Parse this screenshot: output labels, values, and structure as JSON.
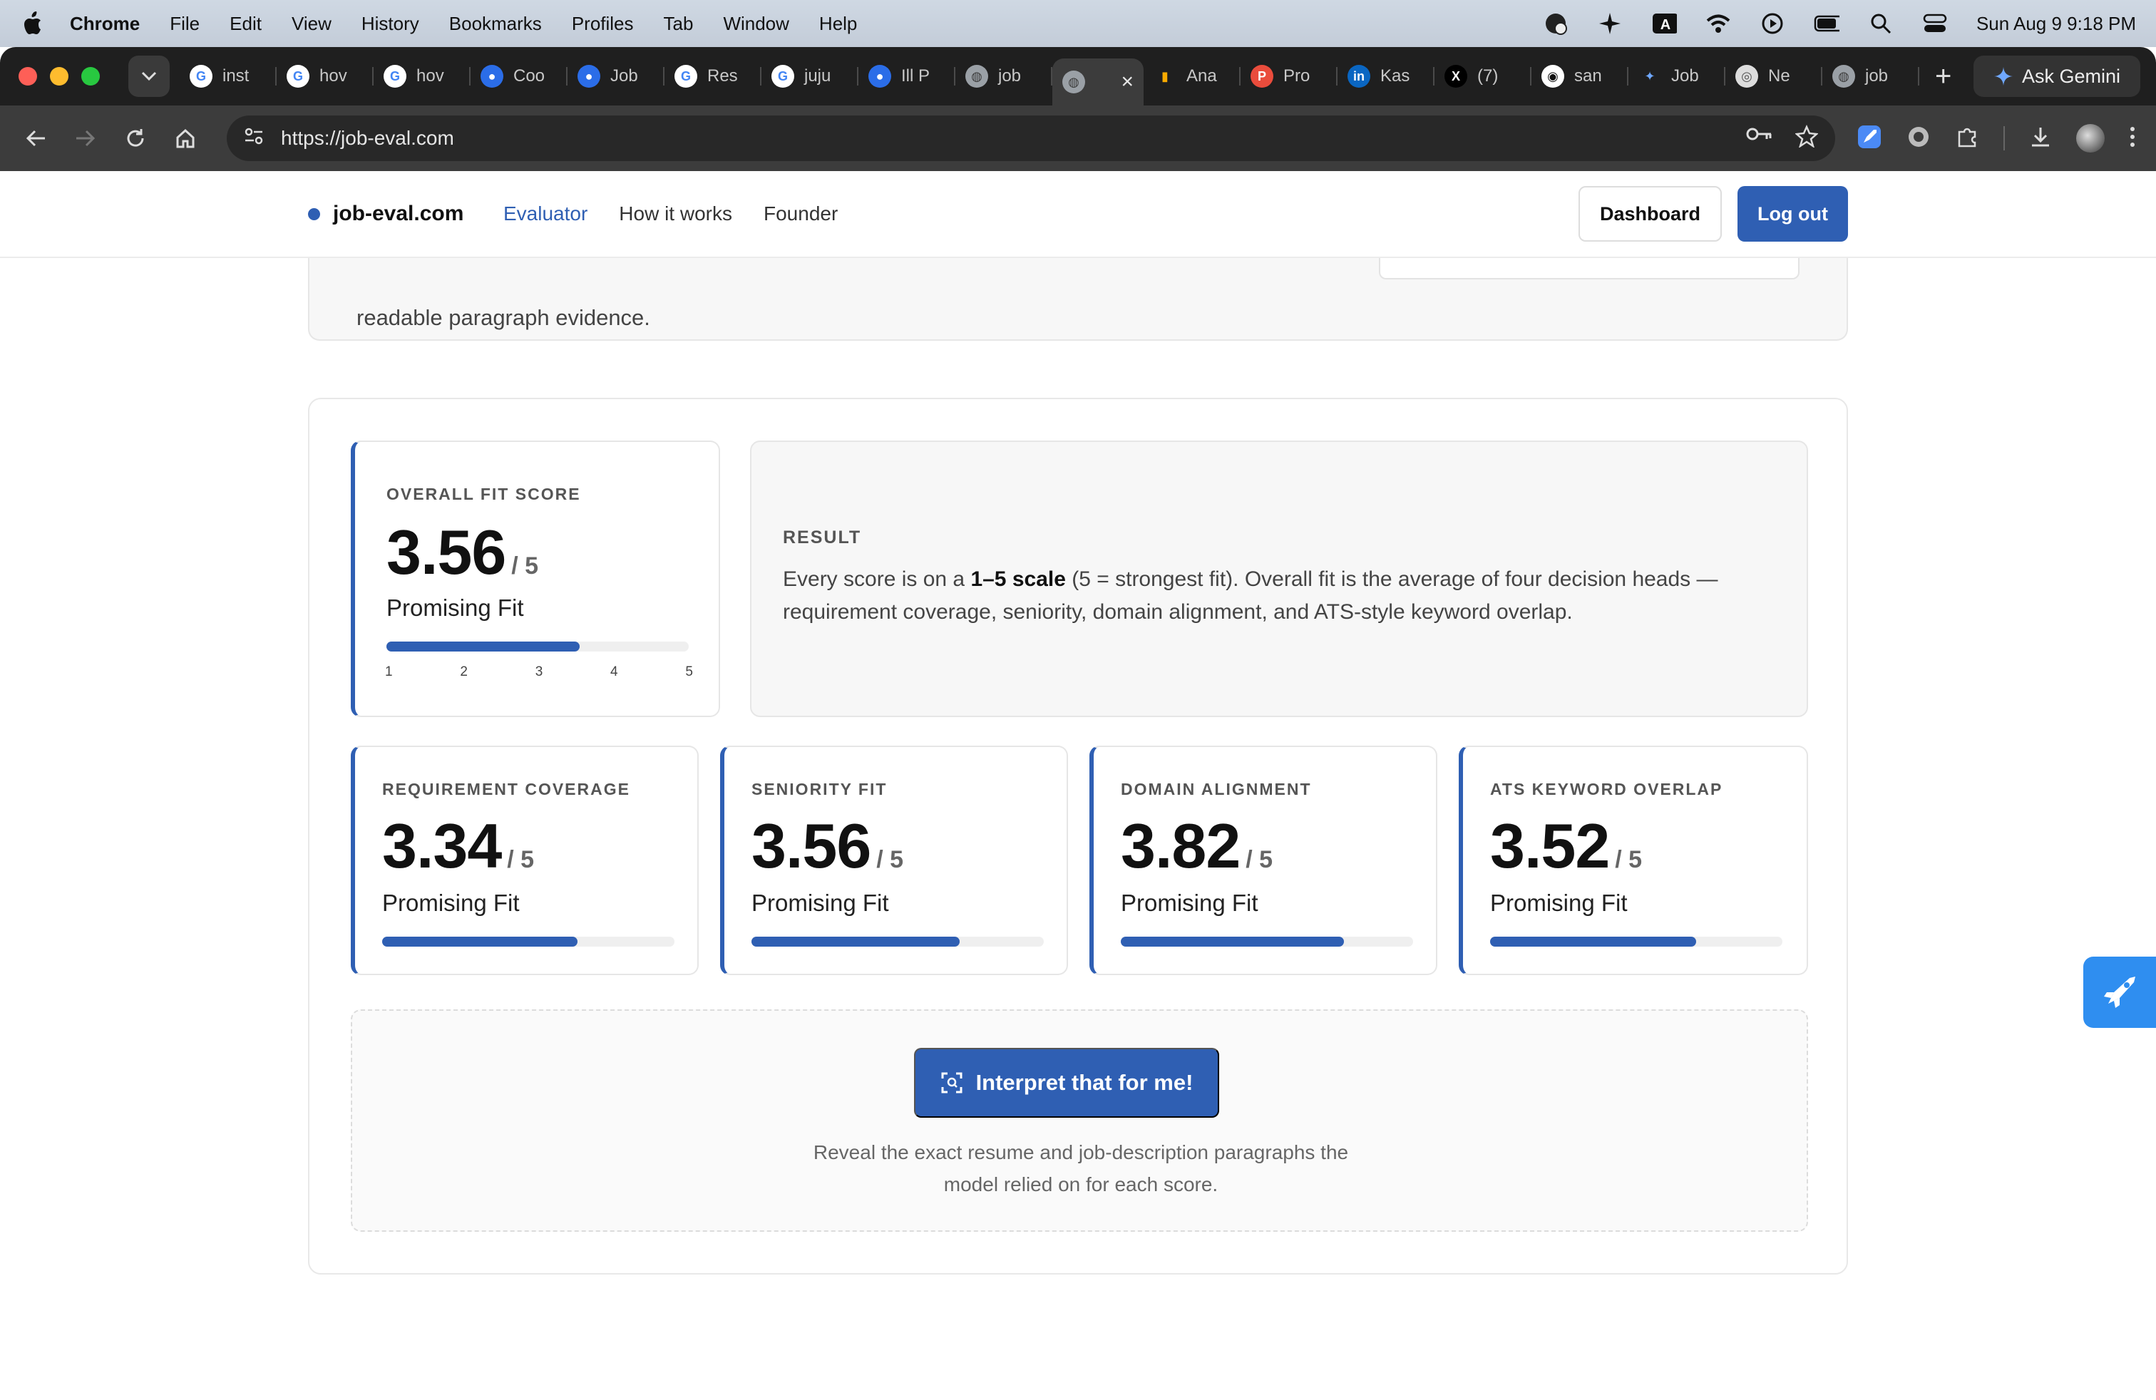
{
  "menubar": {
    "items": [
      "Chrome",
      "File",
      "Edit",
      "View",
      "History",
      "Bookmarks",
      "Profiles",
      "Tab",
      "Window",
      "Help"
    ],
    "clock": "Sun Aug 9  9:18 PM"
  },
  "browser": {
    "tabs": [
      {
        "title": "inst",
        "icon": "google-icon"
      },
      {
        "title": "hov",
        "icon": "google-icon"
      },
      {
        "title": "hov",
        "icon": "google-icon"
      },
      {
        "title": "Coo",
        "icon": "app-icon"
      },
      {
        "title": "Job",
        "icon": "app-icon"
      },
      {
        "title": "Res",
        "icon": "google-icon"
      },
      {
        "title": "juju",
        "icon": "google-icon"
      },
      {
        "title": "Ill P",
        "icon": "app-icon"
      },
      {
        "title": "job",
        "icon": "globe-icon"
      },
      {
        "title": "",
        "icon": "globe-icon",
        "active": true
      },
      {
        "title": "Ana",
        "icon": "analytics-icon"
      },
      {
        "title": "Pro",
        "icon": "product-icon"
      },
      {
        "title": "Kas",
        "icon": "linkedin-icon"
      },
      {
        "title": "(7)",
        "icon": "x-icon"
      },
      {
        "title": "san",
        "icon": "github-icon"
      },
      {
        "title": "Job",
        "icon": "gemini-icon"
      },
      {
        "title": "Ne",
        "icon": "chrome-icon"
      },
      {
        "title": "job",
        "icon": "globe-icon"
      }
    ],
    "gemini_label": "Ask Gemini",
    "url": "https://job-eval.com"
  },
  "site": {
    "brand": "job-eval.com",
    "nav": [
      "Evaluator",
      "How it works",
      "Founder"
    ],
    "dashboard_label": "Dashboard",
    "logout_label": "Log out",
    "accent": "#2f5fb3"
  },
  "previous_section_text": "readable paragraph evidence.",
  "overall": {
    "label": "OVERALL FIT SCORE",
    "score": "3.56",
    "out_of": "/ 5",
    "fit": "Promising Fit",
    "level": 3.56,
    "ticks": [
      "1",
      "2",
      "3",
      "4",
      "5"
    ]
  },
  "result": {
    "label": "RESULT",
    "text_pre": "Every score is on a ",
    "text_bold": "1–5 scale",
    "text_post": " (5 = strongest fit). Overall fit is the average of four decision heads — requirement coverage, seniority, domain alignment, and ATS-style keyword overlap."
  },
  "heads": [
    {
      "label": "REQUIREMENT COVERAGE",
      "score": "3.34",
      "out_of": "/ 5",
      "fit": "Promising Fit",
      "level": 3.34
    },
    {
      "label": "SENIORITY FIT",
      "score": "3.56",
      "out_of": "/ 5",
      "fit": "Promising Fit",
      "level": 3.56
    },
    {
      "label": "DOMAIN ALIGNMENT",
      "score": "3.82",
      "out_of": "/ 5",
      "fit": "Promising Fit",
      "level": 3.82
    },
    {
      "label": "ATS KEYWORD OVERLAP",
      "score": "3.52",
      "out_of": "/ 5",
      "fit": "Promising Fit",
      "level": 3.52
    }
  ],
  "cta": {
    "button_label": "Interpret that for me!",
    "help_line1": "Reveal the exact resume and job-description paragraphs the",
    "help_line2": "model relied on for each score."
  }
}
